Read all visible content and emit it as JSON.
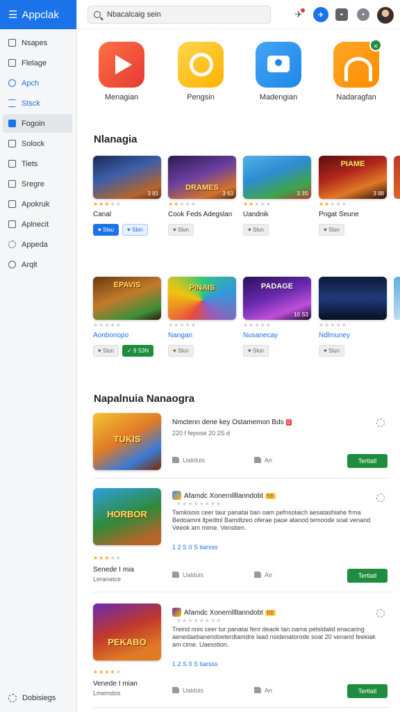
{
  "app": {
    "title": "Appclak"
  },
  "sidebar": {
    "items": [
      {
        "label": "Nsapes"
      },
      {
        "label": "Flelage"
      },
      {
        "label": "Apch"
      },
      {
        "label": "Stsck"
      },
      {
        "label": "Fogoin"
      },
      {
        "label": "Solock"
      },
      {
        "label": "Tiets"
      },
      {
        "label": "Sregre"
      },
      {
        "label": "Apokruk"
      },
      {
        "label": "Aplnecit"
      },
      {
        "label": "Appeda"
      },
      {
        "label": "Arqlt"
      }
    ],
    "footer": "Dobisiegs"
  },
  "search": {
    "value": "Nbacalcaig sein"
  },
  "featured": [
    {
      "name": "Menagian"
    },
    {
      "name": "Pengsin"
    },
    {
      "name": "Madengian"
    },
    {
      "name": "Nadaragfan",
      "badge": "×"
    }
  ],
  "section1": {
    "title": "Nlanagia"
  },
  "row1": [
    {
      "name": "Canal",
      "thumb": "",
      "size": "3 83",
      "rating": 3,
      "btn1": "Slau",
      "btn2": "Sbin"
    },
    {
      "name": "Cook Feds Adegslan",
      "thumb": "DRAMES",
      "size": "3 63",
      "rating": 2,
      "btn1": "Slun"
    },
    {
      "name": "Uandnik",
      "thumb": "",
      "size": "3 3S",
      "rating": 2,
      "btn1": "Slun"
    },
    {
      "name": "Pngat Seune",
      "thumb": "PIAME",
      "size": "3 88",
      "rating": 2,
      "btn1": "Slun"
    }
  ],
  "row2": [
    {
      "name": "Aonbonopo",
      "thumb": "EPAVIS",
      "rating": 0,
      "btn1": "Slun",
      "btn2": "9 S3N"
    },
    {
      "name": "Nangan",
      "thumb": "PINAIS",
      "rating": 0,
      "btn1": "Slun"
    },
    {
      "name": "Nusanecay",
      "thumb": "PADAGE",
      "size": "10 S3",
      "rating": 0,
      "btn1": "Slun"
    },
    {
      "name": "Ndlmuney",
      "thumb": "",
      "rating": 0,
      "btn1": "Slun"
    }
  ],
  "section2": {
    "title": "Napalnuia Nanaogra"
  },
  "list": [
    {
      "thumb": "TUKIS",
      "title": "Nmctenn dene key Ostamemon Bds",
      "tag": "0",
      "meta": "220 f  fepose  20 2S  d",
      "like": "Ualiduis",
      "dl": "An",
      "install": "Tertlatl"
    },
    {
      "thumb": "HORBOR",
      "title": "Afamdc Xonernllllanndobt",
      "tag": "BB",
      "desc": "Tamkisois  ceer taur panatai ban oam pefnsolaich aesatashiahe frma Bedoamnt ltpedtnl Bamdtzeo oferae paoe atanod temoode soat  venand Veeok am mime. Venstien.",
      "meta": "1 2 S  0 S  tiarsss",
      "stars": 3,
      "name": "Senede I mia",
      "dev": "Leranatce",
      "like": "Ualduis",
      "dl": "An",
      "install": "Tertlatl"
    },
    {
      "thumb": "PEKABO",
      "title": "Afamdc Xonernllllanndobt",
      "tag": "BB",
      "desc": "Treirid nnis  ceer tur panatai fenr deaok tan oama petsidalid enacaring aenedaebanendoeterdtamdre  laad nsidenatorode soat  20 venand feekiak am cime. Uaesstion.",
      "meta": "1 2 S  0 S  tiarsss",
      "stars": 4,
      "name": "Venede I mian",
      "dev": "Lmemdos",
      "like": "Ualduis",
      "dl": "An",
      "install": "Tertlatl"
    }
  ],
  "colors": {
    "accent": "#1a73e8",
    "install": "#1e8e3e",
    "star": "#f5a623"
  }
}
